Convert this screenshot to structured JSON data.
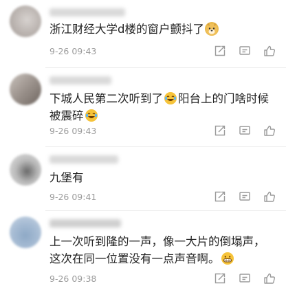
{
  "comments": [
    {
      "text": "浙江财经大学d楼的窗户颤抖了",
      "emoji": "doge-emoji",
      "timestamp": "9-26 09:43"
    },
    {
      "text_part1": "下城人民第二次听到了",
      "emoji": "laugh-cry-emoji",
      "text_part2": "阳台上的门啥时候",
      "text_line2": "被震碎",
      "timestamp": "9-26 09:43"
    },
    {
      "text": "九堡有",
      "timestamp": "9-26 09:41"
    },
    {
      "text_line1": "上一次听到隆的一声，像一大片的倒塌声，",
      "text_line2": "这次在同一位置没有一点声音啊。",
      "emoji": "grin-emoji",
      "timestamp": "9-26 09:38"
    }
  ],
  "action_icons": [
    "share-icon",
    "comment-icon",
    "like-icon"
  ],
  "colors": {
    "text": "#222222",
    "meta": "#9b9b9b",
    "icon": "#9a9a9a",
    "divider": "#ececec"
  }
}
